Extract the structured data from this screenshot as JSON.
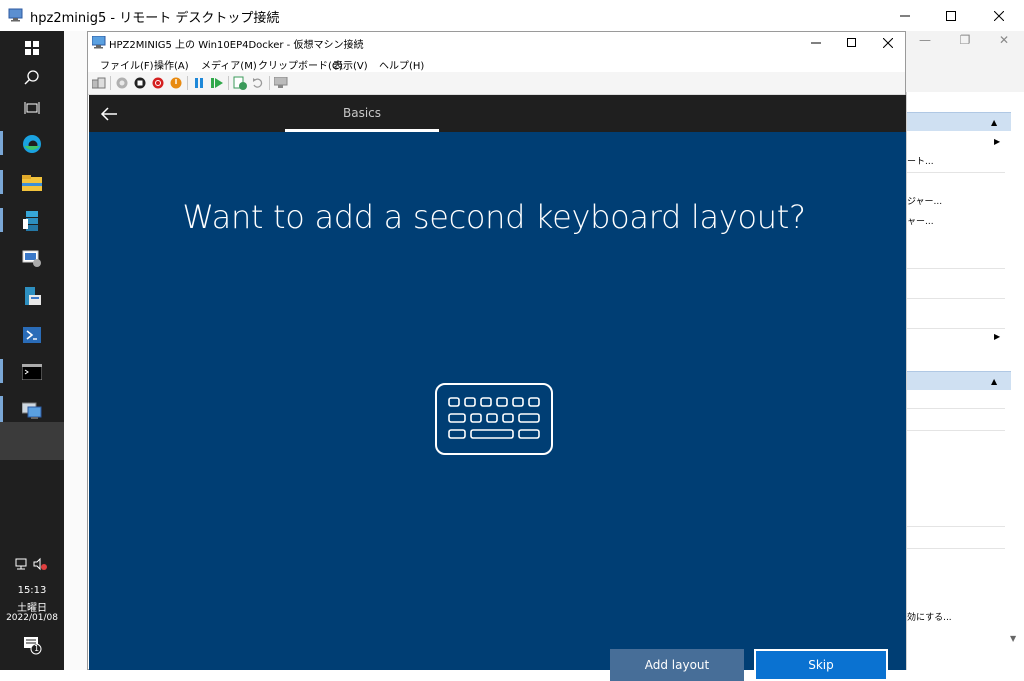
{
  "rdp_window": {
    "title": "hpz2minig5 - リモート デスクトップ接続",
    "icon": "remote-desktop-icon"
  },
  "taskbar": {
    "icons": [
      "windows-start-icon",
      "search-icon",
      "task-view-icon",
      "edge-icon",
      "file-explorer-icon",
      "server-manager-icon",
      "remote-desktop-icon",
      "file-server-icon",
      "powershell-icon",
      "cmd-icon",
      "hyper-v-manager-icon"
    ],
    "tray": {
      "time": "15:13",
      "day": "土曜日",
      "date": "2022/01/08",
      "notification_count": "1"
    }
  },
  "host_app": {
    "side_texts": [
      "ート...",
      "ジャー...",
      "ャー...",
      "効にする..."
    ]
  },
  "vm_window": {
    "title": "HPZ2MINIG5 上の Win10EP4Docker - 仮想マシン接続",
    "menu": [
      "ファイル(F)",
      "操作(A)",
      "メディア(M)",
      "クリップボード(C)",
      "表示(V)",
      "ヘルプ(H)"
    ]
  },
  "oobe": {
    "step_label": "Basics",
    "heading": "Want to add a second keyboard layout?",
    "add_layout_label": "Add layout",
    "skip_label": "Skip",
    "background_color": "#003e74",
    "primary_button_color": "#0a72d1",
    "secondary_button_color": "#476e98"
  }
}
